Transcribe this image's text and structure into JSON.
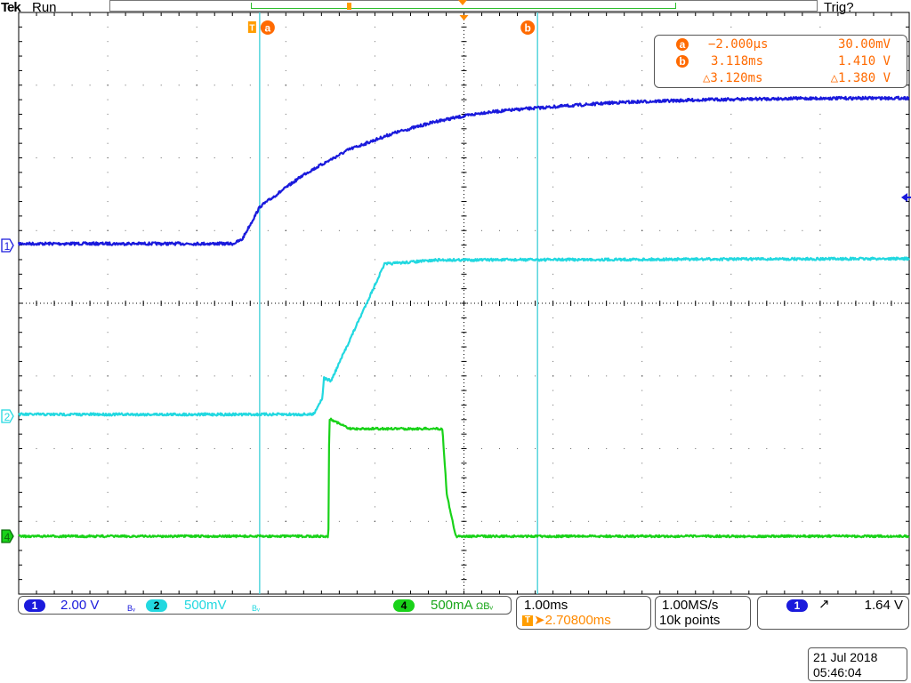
{
  "header": {
    "brand": "Tek",
    "run_state": "Run",
    "trigger_status": "Trig?"
  },
  "cursors": {
    "a": {
      "badge": "a",
      "time": "−2.000µs",
      "value": "30.00mV"
    },
    "b": {
      "badge": "b",
      "time": "3.118ms",
      "value": "1.410 V"
    },
    "delta": {
      "time": "△3.120ms",
      "value": "△1.380 V"
    }
  },
  "channels": [
    {
      "num": "1",
      "scale": "2.00 V",
      "suffix": "Bᵥ",
      "color": "#1a1adc"
    },
    {
      "num": "2",
      "scale": "500mV",
      "suffix": "Bᵥ",
      "color": "#22d8e0"
    },
    {
      "num": "4",
      "scale": "500mA",
      "suffix": "ΩBᵥ",
      "color": "#19d219"
    }
  ],
  "timebase": {
    "scale": "1.00ms",
    "trigger_position": "➤2.70800ms"
  },
  "acquisition": {
    "sample_rate": "1.00MS/s",
    "record_length": "10k points"
  },
  "trigger": {
    "source": "1",
    "slope": "↗",
    "level": "1.64 V"
  },
  "datetime": {
    "date": "21 Jul  2018",
    "time": "05:46:04"
  },
  "chart_data": {
    "type": "line",
    "x_unit": "ms",
    "xlim": [
      -2.708,
      7.292
    ],
    "series": [
      {
        "channel": "1",
        "x": [
          -2.708,
          -0.3,
          -0.2,
          0,
          0.5,
          1,
          1.5,
          2,
          2.5,
          3,
          4,
          5,
          6,
          7.292
        ],
        "y": [
          0.0,
          0.0,
          0.1,
          0.9,
          1.7,
          2.3,
          2.7,
          3.0,
          3.2,
          3.3,
          3.45,
          3.52,
          3.55,
          3.56
        ]
      },
      {
        "channel": "2",
        "x": [
          -2.708,
          0.6,
          0.7,
          0.72,
          0.8,
          1.4,
          2.0,
          7.292
        ],
        "y": [
          0.0,
          0.0,
          0.12,
          0.27,
          0.25,
          1.12,
          1.15,
          1.16
        ]
      },
      {
        "channel": "4",
        "x": [
          -2.708,
          0.77,
          0.78,
          0.8,
          1.0,
          2.05,
          2.1,
          2.2,
          7.292
        ],
        "y": [
          0.0,
          0.0,
          0.85,
          0.85,
          0.78,
          0.78,
          0.3,
          0.0,
          0.0
        ]
      }
    ]
  },
  "colors": {
    "ch1": "#1a1adc",
    "ch2": "#22d8e0",
    "ch4": "#19d219",
    "cursor_accent": "#ff6a00",
    "grid": "#000000"
  }
}
